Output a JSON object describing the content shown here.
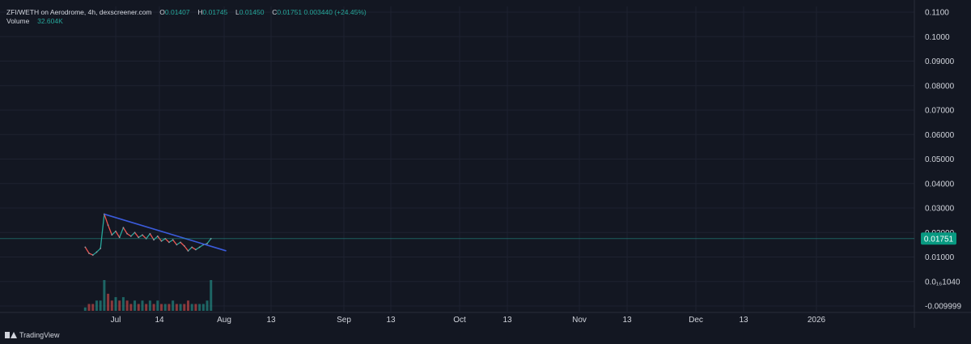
{
  "legend": {
    "symbol": "ZFI/WETH on Aerodrome, 4h, dexscreener.com",
    "o_label": "O",
    "o_value": "0.01407",
    "h_label": "H",
    "h_value": "0.01745",
    "l_label": "L",
    "l_value": "0.01450",
    "c_label": "C",
    "c_value": "0.01751",
    "change": "0.003440 (+24.45%)",
    "volume_label": "Volume",
    "volume_value": "32.604K"
  },
  "brand": {
    "name": "TradingView",
    "icon": "tradingview-logo-icon"
  },
  "colors": {
    "background": "#131722",
    "grid": "#1e2230",
    "text": "#d1d4dc",
    "up": "#26a69a",
    "down": "#ef5350",
    "trendline": "#3b5bdb",
    "price_tag": "#089981"
  },
  "chart_data": {
    "type": "line",
    "title": "",
    "xlabel": "",
    "ylabel": "",
    "x_ticks": [
      "Jul",
      "14",
      "Aug",
      "13",
      "Sep",
      "13",
      "Oct",
      "13",
      "Nov",
      "13",
      "Dec",
      "13",
      "2026"
    ],
    "y_ticks": [
      "0.1100",
      "0.1000",
      "0.09000",
      "0.08000",
      "0.07000",
      "0.06000",
      "0.05000",
      "0.04000",
      "0.03000",
      "0.02000",
      "0.01000",
      "0.0₁₆1040",
      "-0.009999"
    ],
    "ylim": [
      -0.009999,
      0.11
    ],
    "grid": true,
    "current_price": {
      "label": "0.01751",
      "value": 0.01751
    },
    "series": [
      {
        "values": [
          {
            "x": "2025-06-23",
            "y": 0.014
          },
          {
            "x": "2025-06-24",
            "y": 0.0115
          },
          {
            "x": "2025-06-25",
            "y": 0.0108
          },
          {
            "x": "2025-06-26",
            "y": 0.012
          },
          {
            "x": "2025-06-27",
            "y": 0.0135
          },
          {
            "x": "2025-06-28",
            "y": 0.0275
          },
          {
            "x": "2025-06-29",
            "y": 0.023
          },
          {
            "x": "2025-06-30",
            "y": 0.019
          },
          {
            "x": "2025-07-01",
            "y": 0.0205
          },
          {
            "x": "2025-07-02",
            "y": 0.018
          },
          {
            "x": "2025-07-03",
            "y": 0.022
          },
          {
            "x": "2025-07-04",
            "y": 0.0195
          },
          {
            "x": "2025-07-05",
            "y": 0.0185
          },
          {
            "x": "2025-07-06",
            "y": 0.02
          },
          {
            "x": "2025-07-07",
            "y": 0.018
          },
          {
            "x": "2025-07-08",
            "y": 0.019
          },
          {
            "x": "2025-07-09",
            "y": 0.0175
          },
          {
            "x": "2025-07-10",
            "y": 0.0195
          },
          {
            "x": "2025-07-11",
            "y": 0.017
          },
          {
            "x": "2025-07-12",
            "y": 0.0185
          },
          {
            "x": "2025-07-13",
            "y": 0.0165
          },
          {
            "x": "2025-07-14",
            "y": 0.0175
          },
          {
            "x": "2025-07-15",
            "y": 0.016
          },
          {
            "x": "2025-07-16",
            "y": 0.017
          },
          {
            "x": "2025-07-17",
            "y": 0.015
          },
          {
            "x": "2025-07-18",
            "y": 0.016
          },
          {
            "x": "2025-07-19",
            "y": 0.0145
          },
          {
            "x": "2025-07-20",
            "y": 0.0125
          },
          {
            "x": "2025-07-21",
            "y": 0.014
          },
          {
            "x": "2025-07-22",
            "y": 0.013
          },
          {
            "x": "2025-07-23",
            "y": 0.014
          },
          {
            "x": "2025-07-24",
            "y": 0.015
          },
          {
            "x": "2025-07-25",
            "y": 0.0155
          },
          {
            "x": "2025-07-26",
            "y": 0.0175
          }
        ]
      }
    ],
    "volume": [
      1,
      2,
      2,
      3,
      3,
      9,
      5,
      3,
      4,
      3,
      4,
      3,
      2,
      3,
      2,
      3,
      2,
      3,
      2,
      3,
      2,
      2,
      2,
      3,
      2,
      2,
      2,
      3,
      2,
      2,
      2,
      2,
      3,
      9
    ],
    "trendline": {
      "from": {
        "x": "2025-06-28",
        "y": 0.0275
      },
      "to": {
        "x": "2025-07-30",
        "y": 0.0125
      }
    }
  }
}
